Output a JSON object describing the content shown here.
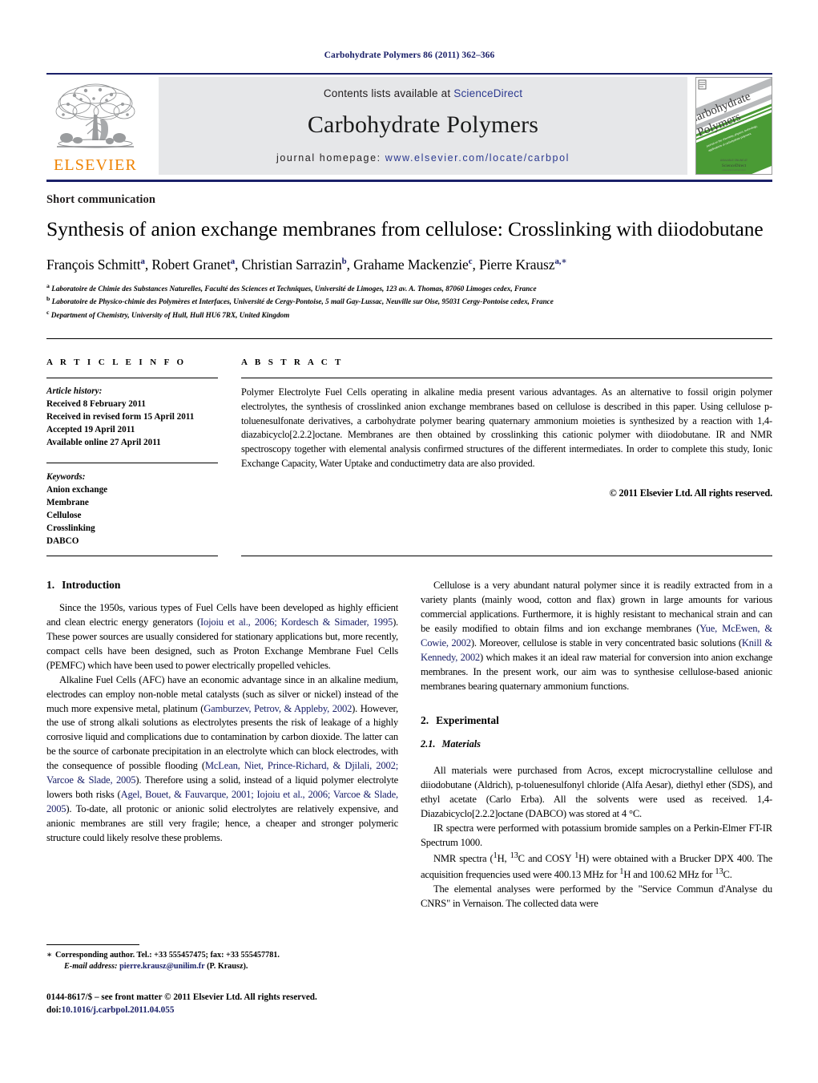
{
  "running_head": "Carbohydrate Polymers 86 (2011) 362–366",
  "masthead": {
    "publisher_name": "ELSEVIER",
    "contents_prefix": "Contents lists available at ",
    "contents_link": "ScienceDirect",
    "journal_title": "Carbohydrate Polymers",
    "homepage_label": "journal homepage:",
    "homepage_url": "www.elsevier.com/locate/carbpol",
    "cover": {
      "line1": "Carbohydrate",
      "line2": "Polymers",
      "subtitle": "journal on the chemistry, physics, technology, applications of carbohydrate",
      "footer": "ScienceDirect",
      "footer_sub": "www.sciencedirect.com"
    },
    "colors": {
      "rule": "#1a2069",
      "band_bg": "#e6e7e9",
      "link": "#2b3990",
      "elsevier_orange": "#ef8200",
      "cover_green": "#4a9b35"
    }
  },
  "article_category": "Short communication",
  "title": "Synthesis of anion exchange membranes from cellulose: Crosslinking with diiodobutane",
  "authors": [
    {
      "name": "François Schmitt",
      "sup": "a",
      "sep": ", "
    },
    {
      "name": "Robert Granet",
      "sup": "a",
      "sep": ", "
    },
    {
      "name": "Christian Sarrazin",
      "sup": "b",
      "sep": ", "
    },
    {
      "name": "Grahame Mackenzie",
      "sup": "c",
      "sep": ", "
    },
    {
      "name": "Pierre Krausz",
      "sup": "a,∗",
      "sep": ""
    }
  ],
  "affiliations": [
    {
      "mark": "a",
      "text": "Laboratoire de Chimie des Substances Naturelles, Faculté des Sciences et Techniques, Université de Limoges, 123 av. A. Thomas, 87060 Limoges cedex, France"
    },
    {
      "mark": "b",
      "text": "Laboratoire de Physico-chimie des Polymères et Interfaces, Université de Cergy-Pontoise, 5 mail Gay-Lussac, Neuville sur Oise, 95031 Cergy-Pontoise cedex, France"
    },
    {
      "mark": "c",
      "text": "Department of Chemistry, University of Hull, Hull HU6 7RX, United Kingdom"
    }
  ],
  "article_info": {
    "heading": "A R T I C L E    I N F O",
    "history_label": "Article history:",
    "history": [
      "Received 8 February 2011",
      "Received in revised form 15 April 2011",
      "Accepted 19 April 2011",
      "Available online 27 April 2011"
    ],
    "keywords_label": "Keywords:",
    "keywords": [
      "Anion exchange",
      "Membrane",
      "Cellulose",
      "Crosslinking",
      "DABCO"
    ]
  },
  "abstract": {
    "heading": "A B S T R A C T",
    "text": "Polymer Electrolyte Fuel Cells operating in alkaline media present various advantages. As an alternative to fossil origin polymer electrolytes, the synthesis of crosslinked anion exchange membranes based on cellulose is described in this paper. Using cellulose p-toluenesulfonate derivatives, a carbohydrate polymer bearing quaternary ammonium moieties is synthesized by a reaction with 1,4-diazabicyclo[2.2.2]octane. Membranes are then obtained by crosslinking this cationic polymer with diiodobutane. IR and NMR spectroscopy together with elemental analysis confirmed structures of the different intermediates. In order to complete this study, Ionic Exchange Capacity, Water Uptake and conductimetry data are also provided.",
    "copyright": "© 2011 Elsevier Ltd. All rights reserved."
  },
  "sections": {
    "introduction": {
      "number": "1.",
      "title": "Introduction",
      "p1_parts": [
        "Since the 1950s, various types of Fuel Cells have been developed as highly efficient and clean electric energy generators (",
        "Iojoiu et al., 2006; Kordesch & Simader, 1995",
        "). These power sources are usually considered for stationary applications but, more recently, compact cells have been designed, such as Proton Exchange Membrane Fuel Cells (PEMFC) which have been used to power electrically propelled vehicles."
      ],
      "p2_parts": [
        "Alkaline Fuel Cells (AFC) have an economic advantage since in an alkaline medium, electrodes can employ non-noble metal catalysts (such as silver or nickel) instead of the much more expensive metal, platinum (",
        "Gamburzev, Petrov, & Appleby, 2002",
        "). However, the use of strong alkali solutions as electrolytes presents the risk of leakage of a highly corrosive liquid and complications due to contamination by carbon dioxide. The latter can be the source of carbonate precipitation in an electrolyte which can block electrodes, with the consequence of possible flooding (",
        "McLean, Niet, Prince-Richard, & Djilali, 2002; Varcoe & Slade, 2005",
        "). Therefore using a solid, instead of a liquid polymer electrolyte lowers both risks (",
        "Agel, Bouet, & Fauvarque, 2001; Iojoiu et al., 2006; Varcoe & Slade, 2005",
        "). To-date, all protonic or anionic solid electrolytes are relatively expensive, and anionic membranes are still very fragile; hence, a cheaper and stronger polymeric structure could likely resolve these problems."
      ],
      "p3_parts": [
        "Cellulose is a very abundant natural polymer since it is readily extracted from in a variety plants (mainly wood, cotton and flax) grown in large amounts for various commercial applications. Furthermore, it is highly resistant to mechanical strain and can be easily modified to obtain films and ion exchange membranes (",
        "Yue, McEwen, & Cowie, 2002",
        "). Moreover, cellulose is stable in very concentrated basic solutions (",
        "Knill & Kennedy, 2002",
        ") which makes it an ideal raw material for conversion into anion exchange membranes. In the present work, our aim was to synthesise cellulose-based anionic membranes bearing quaternary ammonium functions."
      ]
    },
    "experimental": {
      "number": "2.",
      "title": "Experimental",
      "sub_number": "2.1.",
      "sub_title": "Materials",
      "p1": "All materials were purchased from Acros, except microcrystalline cellulose and diiodobutane (Aldrich), p-toluenesulfonyl chloride (Alfa Aesar), diethyl ether (SDS), and ethyl acetate (Carlo Erba). All the solvents were used as received. 1,4-Diazabicyclo[2.2.2]octane (DABCO) was stored at 4 °C.",
      "p2": "IR spectra were performed with potassium bromide samples on a Perkin-Elmer FT-IR Spectrum 1000.",
      "p3_a": "NMR spectra (",
      "p3_b": "H, ",
      "p3_c": "C and COSY ",
      "p3_d": "H) were obtained with a Brucker DPX 400. The acquisition frequencies used were 400.13 MHz for ",
      "p3_e": "H and 100.62 MHz for ",
      "p3_f": "C.",
      "sup1": "1",
      "sup13": "13",
      "p4": "The elemental analyses were performed by the \"Service Commun d'Analyse du CNRS\" in Vernaison. The collected data were"
    }
  },
  "footer": {
    "corresponding_star": "∗",
    "corresponding_text": "Corresponding author. Tel.: +33 555457475; fax: +33 555457781.",
    "email_label": "E-mail address:",
    "email": "pierre.krausz@unilim.fr",
    "email_suffix": "(P. Krausz).",
    "issn_line": "0144-8617/$ – see front matter © 2011 Elsevier Ltd. All rights reserved.",
    "doi_label": "doi:",
    "doi": "10.1016/j.carbpol.2011.04.055"
  }
}
